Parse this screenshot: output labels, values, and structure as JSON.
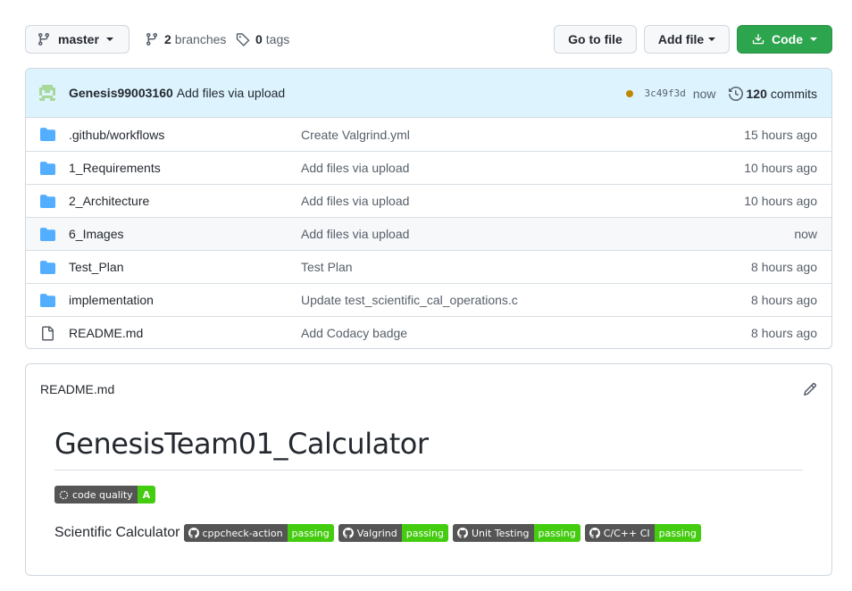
{
  "branch": {
    "name": "master"
  },
  "branches": {
    "count": "2",
    "label": "branches"
  },
  "tags": {
    "count": "0",
    "label": "tags"
  },
  "buttons": {
    "go_to_file": "Go to file",
    "add_file": "Add file",
    "code": "Code"
  },
  "commit": {
    "author": "Genesis99003160",
    "message": "Add files via upload",
    "sha": "3c49f3d",
    "when": "now",
    "commit_count": "120",
    "commits_label": "commits",
    "status_color": "#bf8700"
  },
  "files": [
    {
      "type": "folder",
      "name": ".github/workflows",
      "message": "Create Valgrind.yml",
      "age": "15 hours ago"
    },
    {
      "type": "folder",
      "name": "1_Requirements",
      "message": "Add files via upload",
      "age": "10 hours ago"
    },
    {
      "type": "folder",
      "name": "2_Architecture",
      "message": "Add files via upload",
      "age": "10 hours ago"
    },
    {
      "type": "folder",
      "name": "6_Images",
      "message": "Add files via upload",
      "age": "now"
    },
    {
      "type": "folder",
      "name": "Test_Plan",
      "message": "Test Plan",
      "age": "8 hours ago"
    },
    {
      "type": "folder",
      "name": "implementation",
      "message": "Update test_scientific_cal_operations.c",
      "age": "8 hours ago"
    },
    {
      "type": "file",
      "name": "README.md",
      "message": "Add Codacy badge",
      "age": "8 hours ago"
    }
  ],
  "readme": {
    "filename": "README.md",
    "title": "GenesisTeam01_Calculator",
    "code_quality_badge": {
      "label": "code quality",
      "value": "A"
    },
    "description": "Scientific Calculator",
    "badges": [
      {
        "label": "cppcheck-action",
        "value": "passing"
      },
      {
        "label": "Valgrind",
        "value": "passing"
      },
      {
        "label": "Unit Testing",
        "value": "passing"
      },
      {
        "label": "C/C++ CI",
        "value": "passing"
      }
    ]
  },
  "colors": {
    "accent_green": "#2da44e",
    "folder_blue": "#54aeff",
    "commit_bar_bg": "#ddf4ff"
  }
}
